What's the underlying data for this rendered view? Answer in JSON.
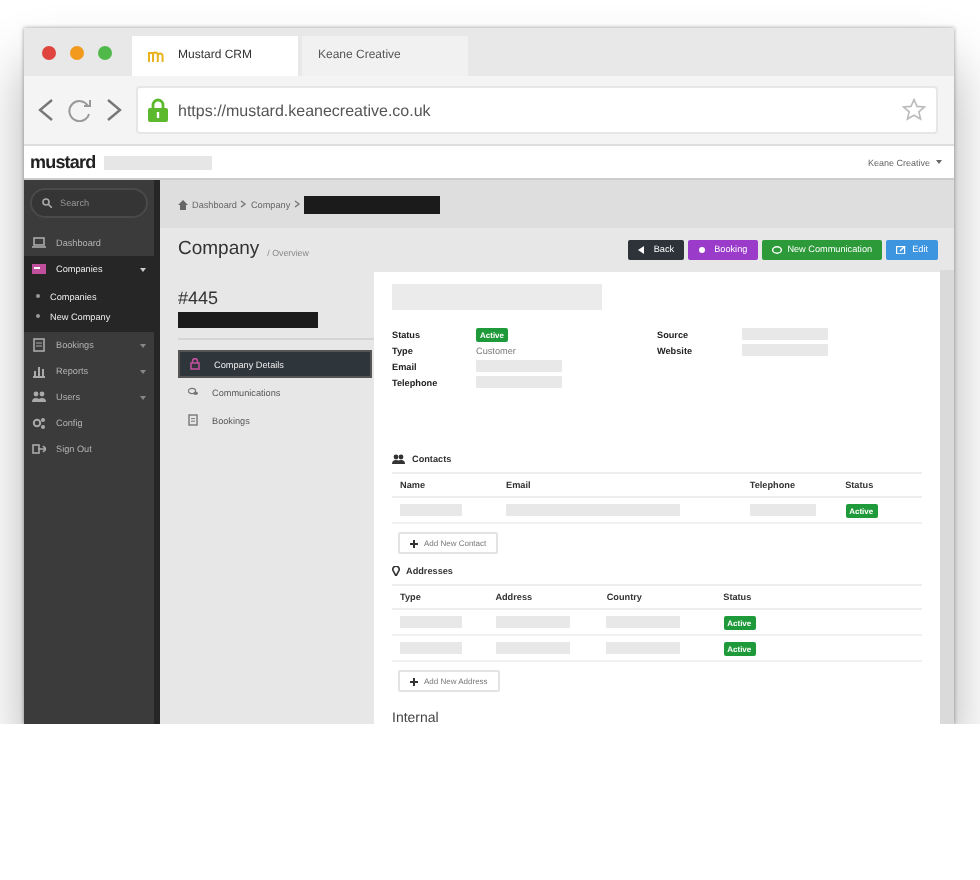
{
  "browser": {
    "tabs": [
      {
        "label": "Mustard CRM",
        "selected": true
      },
      {
        "label": "Keane Creative",
        "selected": false
      }
    ],
    "url": "https://mustard.keanecreative.co.uk"
  },
  "header": {
    "logo": "mustard",
    "user": "Keane Creative"
  },
  "sidebar": {
    "search": {
      "placeholder": "Search"
    },
    "items": [
      {
        "label": "Dashboard",
        "kind": "link",
        "selected": false
      },
      {
        "label": "Companies",
        "kind": "group",
        "selected": true,
        "expanded": true,
        "children": [
          {
            "label": "Companies"
          },
          {
            "label": "New Company"
          }
        ]
      },
      {
        "label": "Bookings",
        "kind": "group",
        "selected": false,
        "expanded": false
      },
      {
        "label": "Reports",
        "kind": "group",
        "selected": false,
        "expanded": false
      },
      {
        "label": "Users",
        "kind": "group",
        "selected": false,
        "expanded": false
      },
      {
        "label": "Config",
        "kind": "link",
        "selected": false
      },
      {
        "label": "Sign Out",
        "kind": "link",
        "selected": false
      }
    ]
  },
  "breadcrumb": [
    "Dashboard",
    "Company"
  ],
  "page": {
    "title": "Company",
    "subtitle": "/ Overview"
  },
  "buttons": [
    {
      "label": "Back",
      "kind": "back"
    },
    {
      "label": "Booking",
      "kind": "booking"
    },
    {
      "label": "New Communication",
      "kind": "communication"
    },
    {
      "label": "Edit",
      "kind": "edit"
    }
  ],
  "record": {
    "number": "#445",
    "nav": [
      {
        "label": "Company Details",
        "selected": true
      },
      {
        "label": "Communications",
        "selected": false
      },
      {
        "label": "Bookings",
        "selected": false
      }
    ]
  },
  "details": {
    "left": [
      {
        "label": "Status",
        "kind": "badge",
        "value": "Active"
      },
      {
        "label": "Type",
        "kind": "text",
        "value": "Customer"
      },
      {
        "label": "Email",
        "kind": "blank"
      },
      {
        "label": "Telephone",
        "kind": "blank"
      }
    ],
    "right": [
      {
        "label": "Source",
        "kind": "blank"
      },
      {
        "label": "Website",
        "kind": "blank"
      }
    ]
  },
  "contacts": {
    "title": "Contacts",
    "columns": [
      "Name",
      "Email",
      "Telephone",
      "Status"
    ],
    "rows": [
      {
        "status": "Active"
      }
    ],
    "add_button": "Add New Contact"
  },
  "addresses": {
    "title": "Addresses",
    "columns": [
      "Type",
      "Address",
      "Country",
      "Status"
    ],
    "rows": [
      {
        "status": "Active"
      },
      {
        "status": "Active"
      }
    ],
    "add_button": "Add New Address"
  },
  "internal": {
    "title": "Internal"
  }
}
